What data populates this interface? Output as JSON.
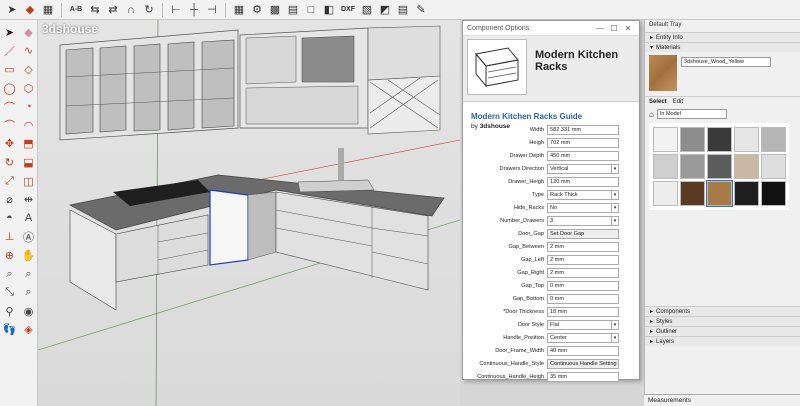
{
  "viewport": {
    "label": "3dshouse"
  },
  "toolbar": {
    "ab": "A-B",
    "dxf": "DXF"
  },
  "dialog": {
    "title": "Component Options",
    "header": "Modern Kitchen Racks",
    "guide": "Modern Kitchen Racks Guide",
    "by_prefix": "by",
    "by_author": "3dshouse",
    "fields": [
      {
        "label": "Width",
        "value": "582.331 mm",
        "type": "text"
      },
      {
        "label": "Heigh",
        "value": "702 mm",
        "type": "text"
      },
      {
        "label": "Drawer Depth",
        "value": "450 mm",
        "type": "text"
      },
      {
        "label": "Drawers Direction",
        "value": "Vertical",
        "type": "select"
      },
      {
        "label": "Drawer_Heigh",
        "value": "120 mm",
        "type": "text"
      },
      {
        "label": "Type",
        "value": "Rack Thick",
        "type": "select"
      },
      {
        "label": "Hide_Racks",
        "value": "No",
        "type": "select"
      },
      {
        "label": "Number_Drawers",
        "value": "3",
        "type": "select"
      },
      {
        "label": "Door_Gap",
        "value": "Set Door Gap",
        "type": "button"
      },
      {
        "label": "Gap_Between",
        "value": "2 mm",
        "type": "text"
      },
      {
        "label": "Gap_Left",
        "value": "2 mm",
        "type": "text"
      },
      {
        "label": "Gap_Right",
        "value": "2 mm",
        "type": "text"
      },
      {
        "label": "Gap_Top",
        "value": "0 mm",
        "type": "text"
      },
      {
        "label": "Gap_Bottom",
        "value": "0 mm",
        "type": "text"
      },
      {
        "label": "*Door Thickness",
        "value": "18 mm",
        "type": "text"
      },
      {
        "label": "Door Style",
        "value": "Flat",
        "type": "select"
      },
      {
        "label": "Handle_Position",
        "value": "Center",
        "type": "select"
      },
      {
        "label": "Door_Frame_Width",
        "value": "40 mm",
        "type": "text"
      },
      {
        "label": "Continuous_Handle_Style",
        "value": "Continuous Handle Setting",
        "type": "button"
      },
      {
        "label": "Continuous_Handle_Heigh",
        "value": "35 mm",
        "type": "text"
      }
    ]
  },
  "tray": {
    "title": "Default Tray",
    "entity_info": "Entity Info",
    "materials": "Materials",
    "material_name": "3dshouse_Wood_Yellow",
    "tab_select": "Select",
    "tab_edit": "Edit",
    "model_select": "In Model",
    "swatches": [
      "#f2f2f2",
      "#8d8d8d",
      "#3a3a3a",
      "#e6e6e6",
      "#b5b5b5",
      "#cfcfcf",
      "#9a9a9a",
      "#5c5c5c",
      "#c8b8a4",
      "#dedede",
      "#ededed",
      "#5a3a22",
      "#a87a45",
      "#1e1e1e",
      "#111111"
    ],
    "sections": [
      "Components",
      "Styles",
      "Outliner",
      "Layers"
    ]
  },
  "measurements": {
    "label": "Measurements"
  }
}
